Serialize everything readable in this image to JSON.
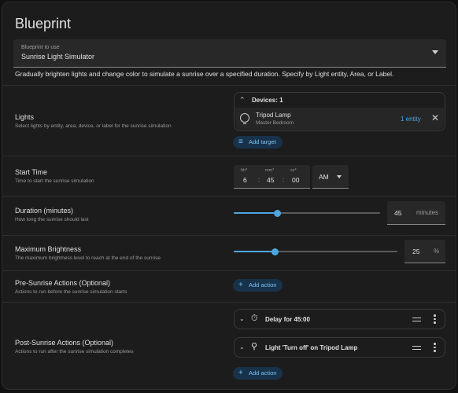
{
  "header": {
    "title": "Blueprint"
  },
  "blueprint_picker": {
    "label": "Blueprint to use",
    "value": "Sunrise Light Simulator"
  },
  "description": "Gradually brighten lights and change color to simulate a sunrise over a specified duration. Specify by Light entity, Area, or Label.",
  "lights": {
    "title": "Lights",
    "subtitle": "Select lights by entity, area, device, or label for the sunrise simulation",
    "devices_header": "Devices: 1",
    "device": {
      "name": "Tripod Lamp",
      "area": "Master Bedroom",
      "entity_count": "1 entity"
    },
    "add_target_label": "Add target"
  },
  "start_time": {
    "title": "Start Time",
    "subtitle": "Time to start the sunrise simulation",
    "hh_label": "hh*",
    "hh": "6",
    "mm_label": "mm*",
    "mm": "45",
    "ss_label": "ss*",
    "ss": "00",
    "separator": ":",
    "ampm": "AM"
  },
  "duration": {
    "title": "Duration (minutes)",
    "subtitle": "How long the sunrise should last",
    "value": "45",
    "unit": "minutes",
    "slider_fraction": 0.3
  },
  "max_brightness": {
    "title": "Maximum Brightness",
    "subtitle": "The maximum brightness level to reach at the end of the sunrise",
    "value": "25",
    "unit": "%",
    "slider_fraction": 0.25
  },
  "pre_sunrise": {
    "title": "Pre-Sunrise Actions (Optional)",
    "subtitle": "Actions to run before the sunrise simulation starts",
    "add_action_label": "Add action"
  },
  "post_sunrise": {
    "title": "Post-Sunrise Actions (Optional)",
    "subtitle": "Actions to run after the sunrise simulation completes",
    "actions": [
      {
        "icon": "timer-icon",
        "label": "Delay for 45:00"
      },
      {
        "icon": "lightbulb-off-icon",
        "label": "Light 'Turn off' on Tripod Lamp"
      }
    ],
    "add_action_label": "Add action"
  },
  "colors": {
    "accent": "#4ea6e0",
    "background": "#1c1c1c",
    "pill_bg": "#17324a"
  }
}
